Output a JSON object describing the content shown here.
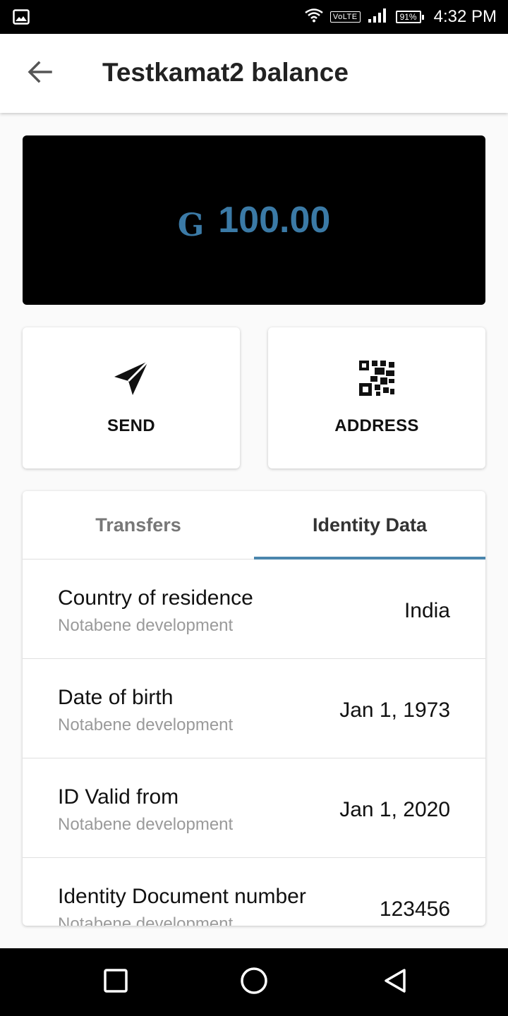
{
  "status_bar": {
    "volte": "VoLTE",
    "battery": "91%",
    "time": "4:32 PM"
  },
  "header": {
    "title": "Testkamat2 balance",
    "back_icon": "arrow-left-icon"
  },
  "balance": {
    "currency_symbol": "G",
    "amount": "100.00",
    "amount_color": "#3b7aa6"
  },
  "actions": {
    "send": {
      "label": "SEND",
      "icon": "send-icon"
    },
    "address": {
      "label": "ADDRESS",
      "icon": "qr-code-icon"
    }
  },
  "tabs": [
    {
      "label": "Transfers",
      "active": false
    },
    {
      "label": "Identity Data",
      "active": true
    }
  ],
  "identity_rows": [
    {
      "title": "Country of residence",
      "source": "Notabene development",
      "value": "India"
    },
    {
      "title": "Date of birth",
      "source": "Notabene development",
      "value": "Jan 1, 1973"
    },
    {
      "title": "ID Valid from",
      "source": "Notabene development",
      "value": "Jan 1, 2020"
    },
    {
      "title": "Identity Document number",
      "source": "Notabene development",
      "value": "123456"
    }
  ],
  "colors": {
    "accent": "#4a86ad",
    "card_background": "#000000"
  }
}
